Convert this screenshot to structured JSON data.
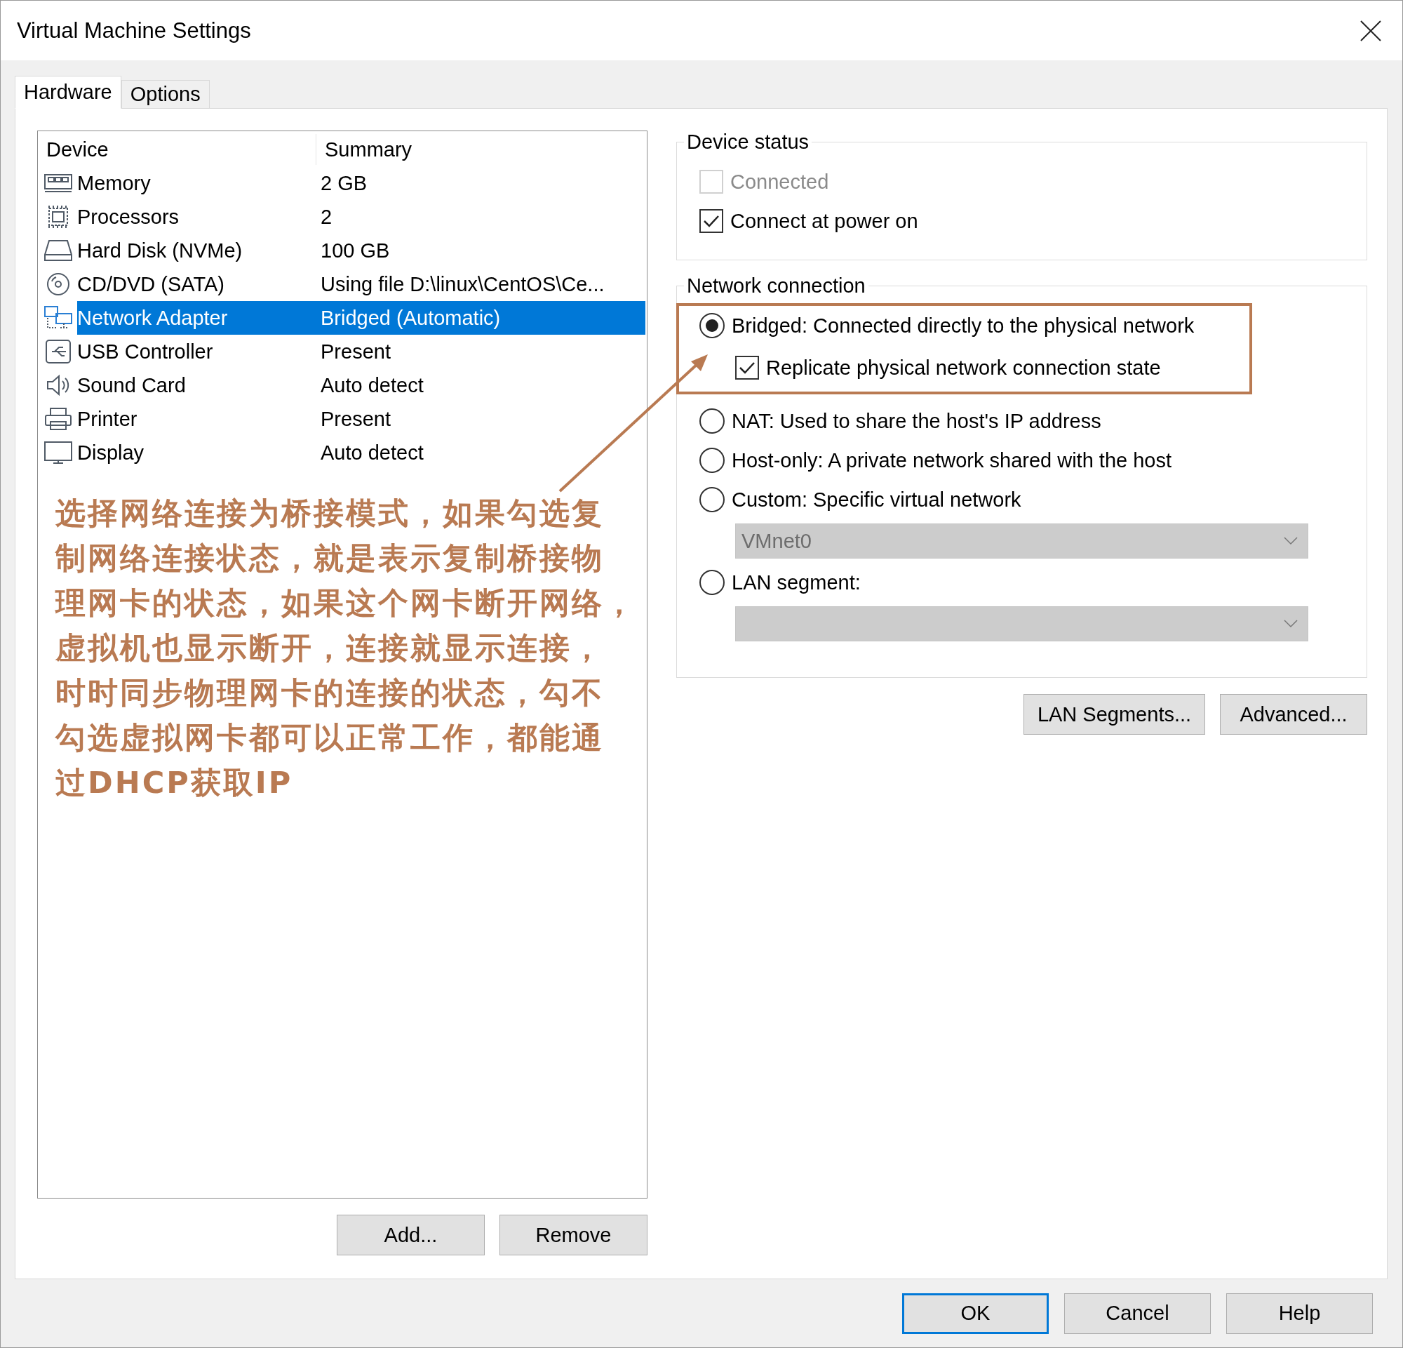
{
  "window": {
    "title": "Virtual Machine Settings"
  },
  "tabs": [
    {
      "label": "Hardware",
      "selected": true
    },
    {
      "label": "Options",
      "selected": false
    }
  ],
  "device_list": {
    "columns": [
      "Device",
      "Summary"
    ],
    "rows": [
      {
        "device": "Memory",
        "summary": "2 GB",
        "selected": false
      },
      {
        "device": "Processors",
        "summary": "2",
        "selected": false
      },
      {
        "device": "Hard Disk (NVMe)",
        "summary": "100 GB",
        "selected": false
      },
      {
        "device": "CD/DVD (SATA)",
        "summary": "Using file D:\\linux\\CentOS\\Ce...",
        "selected": false
      },
      {
        "device": "Network Adapter",
        "summary": "Bridged (Automatic)",
        "selected": true
      },
      {
        "device": "USB Controller",
        "summary": "Present",
        "selected": false
      },
      {
        "device": "Sound Card",
        "summary": "Auto detect",
        "selected": false
      },
      {
        "device": "Printer",
        "summary": "Present",
        "selected": false
      },
      {
        "device": "Display",
        "summary": "Auto detect",
        "selected": false
      }
    ]
  },
  "annotation": {
    "lines": [
      "选择网络连接为桥接模式，如果勾选复",
      "制网络连接状态，就是表示复制桥接物",
      "理网卡的状态，如果这个网卡断开网络，",
      "虚拟机也显示断开，连接就显示连接，",
      "时时同步物理网卡的连接的状态，勾不",
      "勾选虚拟网卡都可以正常工作，都能通",
      "过DHCP获取IP"
    ]
  },
  "list_buttons": [
    "Add...",
    "Remove"
  ],
  "device_status": {
    "title": "Device status",
    "options": [
      {
        "label": "Connected",
        "checked": false,
        "disabled": true
      },
      {
        "label": "Connect at power on",
        "checked": true,
        "disabled": false
      }
    ]
  },
  "network_connection": {
    "title": "Network connection",
    "options": [
      {
        "kind": "radio",
        "label": "Bridged: Connected directly to the physical network",
        "selected": true
      },
      {
        "kind": "checkbox",
        "label": "Replicate physical network connection state",
        "checked": true
      },
      {
        "kind": "radio",
        "label": "NAT: Used to share the host's IP address",
        "selected": false
      },
      {
        "kind": "radio",
        "label": "Host-only: A private network shared with the host",
        "selected": false
      },
      {
        "kind": "radio",
        "label": "Custom: Specific virtual network",
        "selected": false
      },
      {
        "kind": "dropdown",
        "value": "VMnet0",
        "disabled": true
      },
      {
        "kind": "radio",
        "label": "LAN segment:",
        "selected": false
      },
      {
        "kind": "dropdown",
        "disabled": true
      }
    ]
  },
  "network_buttons": [
    "LAN Segments...",
    "Advanced..."
  ],
  "dialog_buttons": [
    {
      "label": "OK",
      "default": true
    },
    {
      "label": "Cancel",
      "default": false
    },
    {
      "label": "Help",
      "default": false
    }
  ]
}
